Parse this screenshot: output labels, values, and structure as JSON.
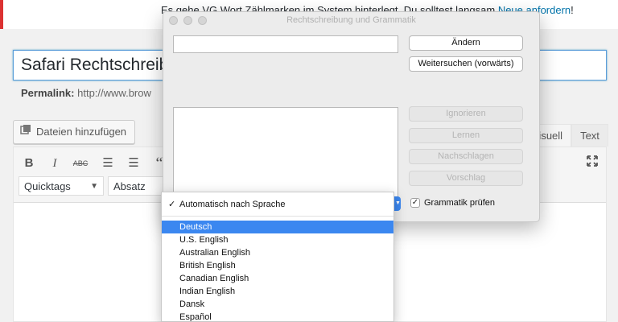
{
  "notice": {
    "text": "Es gehe VG Wort Zählmarken im System hinterlegt. Du solltest langsam ",
    "link": "Neue anfordern",
    "suffix": "!"
  },
  "post": {
    "title_value": "Safari Rechtschreibprüfung",
    "permalink_label": "Permalink:",
    "permalink_url": "http://www.brow"
  },
  "media_button": "Dateien hinzufügen",
  "editor_tabs": [
    "Visuell",
    "Text"
  ],
  "toolbar": {
    "format_select": "Quicktags",
    "paragraph_select": "Absatz"
  },
  "spelling_panel": {
    "title": "Rechtschreibung und Grammatik",
    "word_field_value": "",
    "buttons": {
      "change": "Ändern",
      "find_next": "Weitersuchen (vorwärts)",
      "ignore": "Ignorieren",
      "learn": "Lernen",
      "lookup": "Nachschlagen",
      "guess": "Vorschlag"
    },
    "grammar_label": "Grammatik prüfen",
    "grammar_checked": true
  },
  "language_menu": {
    "selected_check": "✓",
    "auto_item": "Automatisch nach Sprache",
    "items": [
      "Deutsch",
      "U.S. English",
      "Australian English",
      "British English",
      "Canadian English",
      "Indian English",
      "Dansk",
      "Español"
    ],
    "highlighted": "Deutsch",
    "highlight_color": "#3b87f0"
  }
}
